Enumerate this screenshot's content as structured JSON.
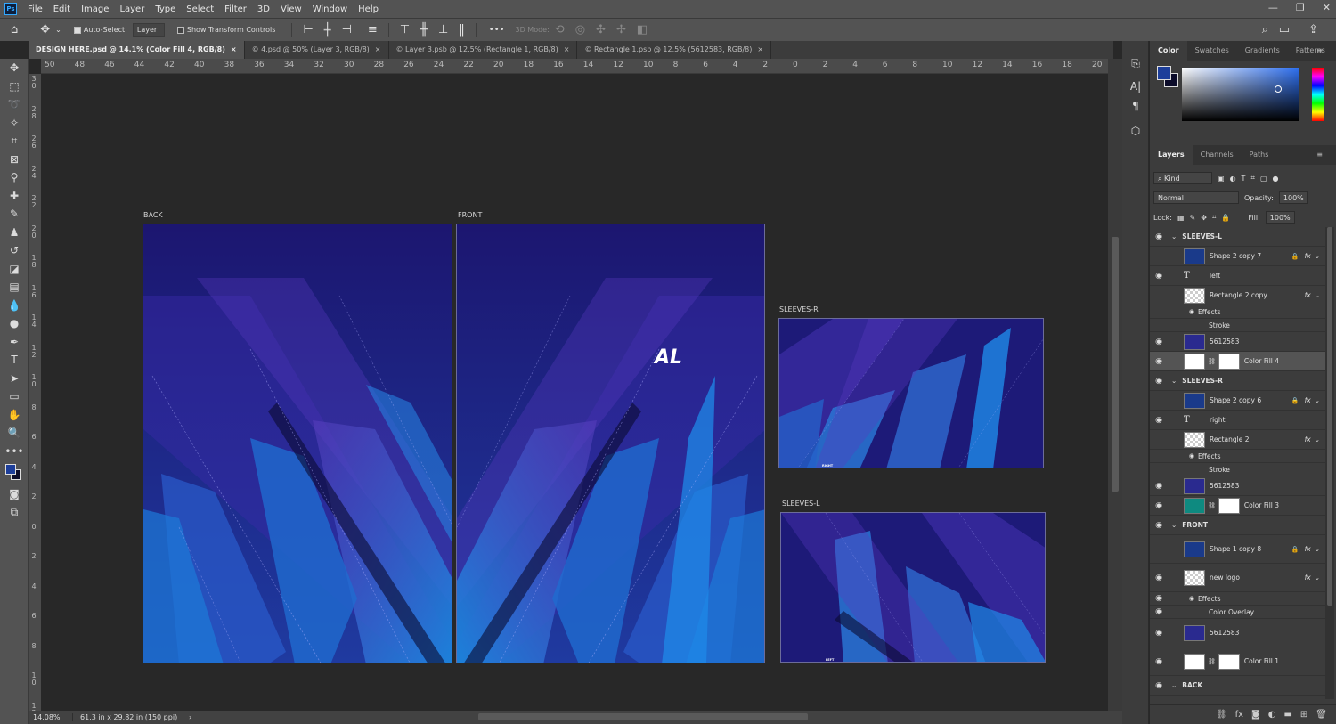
{
  "menu": {
    "app_badge": "Ps",
    "items": [
      "File",
      "Edit",
      "Image",
      "Layer",
      "Type",
      "Select",
      "Filter",
      "3D",
      "View",
      "Window",
      "Help"
    ],
    "window_controls": [
      "—",
      "❐",
      "✕"
    ]
  },
  "options": {
    "auto_select": "Auto-Select:",
    "auto_select_target": "Layer",
    "show_transform": "Show Transform Controls",
    "mode_3d": "3D Mode:",
    "more": "•••"
  },
  "tabs": [
    {
      "label": "DESIGN HERE.psd @ 14.1% (Color Fill 4, RGB/8)",
      "close": "×"
    },
    {
      "label": "© 4.psd @ 50% (Layer 3, RGB/8)",
      "close": "×"
    },
    {
      "label": "© Layer 3.psb @ 12.5% (Rectangle 1, RGB/8)",
      "close": "×"
    },
    {
      "label": "© Rectangle 1.psb @ 12.5% (5612583, RGB/8)",
      "close": "×"
    }
  ],
  "ruler_top": [
    "50",
    "48",
    "46",
    "44",
    "42",
    "40",
    "38",
    "36",
    "34",
    "32",
    "30",
    "28",
    "26",
    "24",
    "22",
    "20",
    "18",
    "16",
    "14",
    "12",
    "10",
    "8",
    "6",
    "4",
    "2",
    "0",
    "2",
    "4",
    "6",
    "8",
    "10",
    "12",
    "14",
    "16",
    "18",
    "20",
    "2"
  ],
  "ruler_left": [
    "3 0",
    "2 8",
    "2 6",
    "2 4",
    "2 2",
    "2 0",
    "1 8",
    "1 6",
    "1 4",
    "1 2",
    "1 0",
    "8",
    "6",
    "4",
    "2",
    "0",
    "2",
    "4",
    "6",
    "8",
    "1 0",
    "1 2"
  ],
  "artboards": {
    "back": "BACK",
    "front": "FRONT",
    "sleeves_r": "SLEEVES-R",
    "sleeves_l": "SLEEVES-L",
    "logo_text": "AL",
    "sleeve_r_tag": "RIGHT",
    "sleeve_l_tag": "LEFT"
  },
  "status": {
    "zoom": "14.08%",
    "doc_info": "61.3 in x 29.82 in (150 ppi)"
  },
  "color_panel": {
    "tabs": [
      "Color",
      "Swatches",
      "Gradients",
      "Patterns"
    ],
    "foreground": "#1d3e9a",
    "background": "#0c0c2a"
  },
  "layers_panel": {
    "tabs": [
      "Layers",
      "Channels",
      "Paths"
    ],
    "filter_kind": "Kind",
    "blend_mode": "Normal",
    "opacity_label": "Opacity:",
    "opacity": "100%",
    "lock_label": "Lock:",
    "fill_label": "Fill:",
    "fill": "100%",
    "rows": [
      {
        "name": "SLEEVES-L",
        "type": "group",
        "visible": true
      },
      {
        "name": "Shape 2 copy 7",
        "type": "layer",
        "visible": false,
        "thumb": "#1a3a8a",
        "locked": true,
        "fx": true
      },
      {
        "name": "left",
        "type": "text",
        "visible": true
      },
      {
        "name": "Rectangle 2 copy",
        "type": "layer",
        "visible": false,
        "thumb": "checker",
        "fx": true
      },
      {
        "name": "Effects",
        "type": "sub",
        "visible": false
      },
      {
        "name": "Stroke",
        "type": "sub2",
        "visible": false
      },
      {
        "name": "5612583",
        "type": "layer",
        "visible": true,
        "thumb": "#2a2a8f"
      },
      {
        "name": "Color Fill 4",
        "type": "fill",
        "visible": true,
        "thumb": "#ffffff",
        "selected": true
      },
      {
        "name": "SLEEVES-R",
        "type": "group",
        "visible": true
      },
      {
        "name": "Shape 2 copy 6",
        "type": "layer",
        "visible": false,
        "thumb": "#1a3a8a",
        "locked": true,
        "fx": true
      },
      {
        "name": "right",
        "type": "text",
        "visible": true
      },
      {
        "name": "Rectangle 2",
        "type": "layer",
        "visible": false,
        "thumb": "checker",
        "fx": true
      },
      {
        "name": "Effects",
        "type": "sub",
        "visible": false
      },
      {
        "name": "Stroke",
        "type": "sub2",
        "visible": false
      },
      {
        "name": "5612583",
        "type": "layer",
        "visible": true,
        "thumb": "#2a2a8f"
      },
      {
        "name": "Color Fill 3",
        "type": "fill",
        "visible": true,
        "thumb": "#0e8a80"
      },
      {
        "name": "FRONT",
        "type": "group",
        "visible": true
      },
      {
        "name": "Shape 1 copy 8",
        "type": "layer",
        "visible": false,
        "thumb": "#1a3a8a",
        "locked": true,
        "fx": true
      },
      {
        "name": "new logo",
        "type": "layer",
        "visible": true,
        "thumb": "checker",
        "fx": true
      },
      {
        "name": "Effects",
        "type": "sub",
        "visible": true
      },
      {
        "name": "Color Overlay",
        "type": "sub2",
        "visible": true
      },
      {
        "name": "5612583",
        "type": "layer",
        "visible": true,
        "thumb": "#2a2a8f"
      },
      {
        "name": "Color Fill 1",
        "type": "fill",
        "visible": true,
        "thumb": "#ffffff"
      },
      {
        "name": "BACK",
        "type": "group",
        "visible": true
      }
    ],
    "fx_label": "fx",
    "lock_icon": "🔒",
    "eye_icon": "👁",
    "text_icon": "T",
    "chevron": "⌄"
  }
}
